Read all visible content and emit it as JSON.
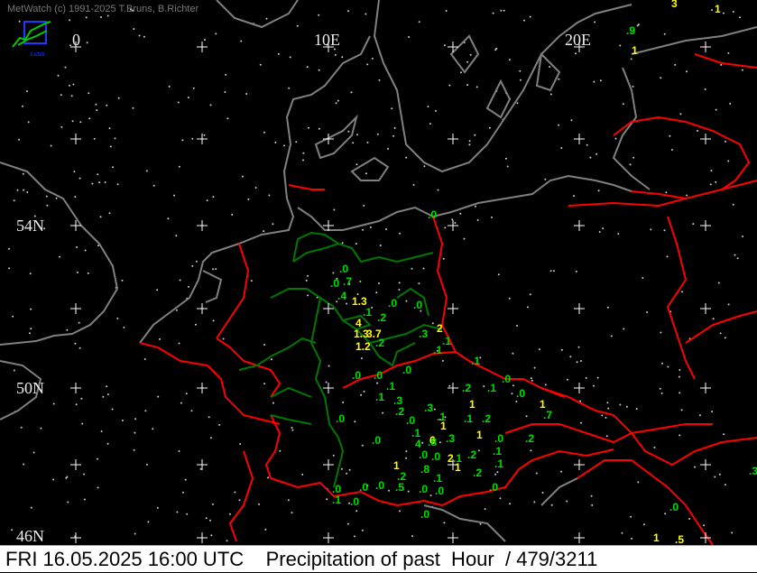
{
  "app": {
    "credit": "MetWatch  (c) 1991-2025 T.Bruns, B.Richter"
  },
  "axes": {
    "lon_labels": [
      "0",
      "10E",
      "20E"
    ],
    "lat_labels": [
      "54N",
      "50N",
      "46N"
    ]
  },
  "footer": {
    "datetime": "FRI 16.05.2025 16:00 UTC",
    "product": "Precipitation of past  Hour",
    "counts": "/ 479/3211"
  },
  "colors": {
    "background": "#000000",
    "coastline": "#808080",
    "country_border": "#ff0000",
    "state_border": "#008000",
    "value_green": "#00dd00",
    "value_yellow": "#ffff00",
    "grid_cross": "#ffffff"
  },
  "observations": [
    {
      "v": "3",
      "c": "y"
    },
    {
      "v": "1",
      "c": "y"
    },
    {
      "v": ".9",
      "c": "g"
    },
    {
      "v": "1",
      "c": "y"
    },
    {
      "v": ".0",
      "c": "g"
    },
    {
      "v": ".0",
      "c": "g"
    },
    {
      "v": ".7",
      "c": "g"
    },
    {
      "v": ".4",
      "c": "g"
    },
    {
      "v": ".0",
      "c": "g"
    },
    {
      "v": "1.3",
      "c": "y"
    },
    {
      "v": ".1",
      "c": "g"
    },
    {
      "v": ".0",
      "c": "g"
    },
    {
      "v": ".0",
      "c": "g"
    },
    {
      "v": ".2",
      "c": "g"
    },
    {
      "v": "4",
      "c": "y"
    },
    {
      "v": "1.3",
      "c": "y"
    },
    {
      "v": "3.7",
      "c": "y"
    },
    {
      "v": ".3",
      "c": "g"
    },
    {
      "v": ".2",
      "c": "g"
    },
    {
      "v": "1.2",
      "c": "y"
    },
    {
      "v": "2",
      "c": "y"
    },
    {
      "v": ".1",
      "c": "g"
    },
    {
      "v": ".1",
      "c": "g"
    },
    {
      "v": ".1",
      "c": "g"
    },
    {
      "v": ".0",
      "c": "g"
    },
    {
      "v": ".0",
      "c": "g"
    },
    {
      "v": ".0",
      "c": "g"
    },
    {
      "v": ".1",
      "c": "g"
    },
    {
      "v": ".1",
      "c": "g"
    },
    {
      "v": ".3",
      "c": "g"
    },
    {
      "v": ".0",
      "c": "g"
    },
    {
      "v": ".2",
      "c": "g"
    },
    {
      "v": ".1",
      "c": "g"
    },
    {
      "v": ".0",
      "c": "g"
    },
    {
      "v": ".2",
      "c": "g"
    },
    {
      "v": "1",
      "c": "y"
    },
    {
      "v": ".3",
      "c": "g"
    },
    {
      "v": ".1",
      "c": "g"
    },
    {
      "v": "1",
      "c": "y"
    },
    {
      "v": ".7",
      "c": "g"
    },
    {
      "v": ".0",
      "c": "g"
    },
    {
      "v": ".1",
      "c": "g"
    },
    {
      "v": ".2",
      "c": "g"
    },
    {
      "v": "1",
      "c": "y"
    },
    {
      "v": ".1",
      "c": "g"
    },
    {
      "v": ".3",
      "c": "g"
    },
    {
      "v": ".0",
      "c": "g"
    },
    {
      "v": ".0",
      "c": "g"
    },
    {
      "v": "1",
      "c": "y"
    },
    {
      "v": "6",
      "c": "y"
    },
    {
      "v": ".0",
      "c": "g"
    },
    {
      "v": ".2",
      "c": "g"
    },
    {
      "v": ".8",
      "c": "g"
    },
    {
      "v": "4",
      "c": "g"
    },
    {
      "v": ".0",
      "c": "g"
    },
    {
      "v": ".0",
      "c": "g"
    },
    {
      "v": "2",
      "c": "y"
    },
    {
      "v": ".2",
      "c": "g"
    },
    {
      "v": ".1",
      "c": "g"
    },
    {
      "v": ".1",
      "c": "g"
    },
    {
      "v": "1",
      "c": "y"
    },
    {
      "v": ".8",
      "c": "g"
    },
    {
      "v": "1",
      "c": "y"
    },
    {
      "v": ".2",
      "c": "g"
    },
    {
      "v": ".1",
      "c": "g"
    },
    {
      "v": ".2",
      "c": "g"
    },
    {
      "v": ".1",
      "c": "g"
    },
    {
      "v": ".0",
      "c": "g"
    },
    {
      "v": ".0",
      "c": "g"
    },
    {
      "v": ".5",
      "c": "g"
    },
    {
      "v": ".0",
      "c": "g"
    },
    {
      "v": ".0",
      "c": "g"
    },
    {
      "v": ".0",
      "c": "g"
    },
    {
      "v": ".0",
      "c": "g"
    },
    {
      "v": ".0",
      "c": "g"
    },
    {
      "v": ".1",
      "c": "g"
    },
    {
      "v": ".0",
      "c": "g"
    },
    {
      "v": "1",
      "c": "y"
    },
    {
      "v": ".5",
      "c": "y"
    },
    {
      "v": ".3",
      "c": "g"
    },
    {
      "v": ".0",
      "c": "g"
    }
  ]
}
